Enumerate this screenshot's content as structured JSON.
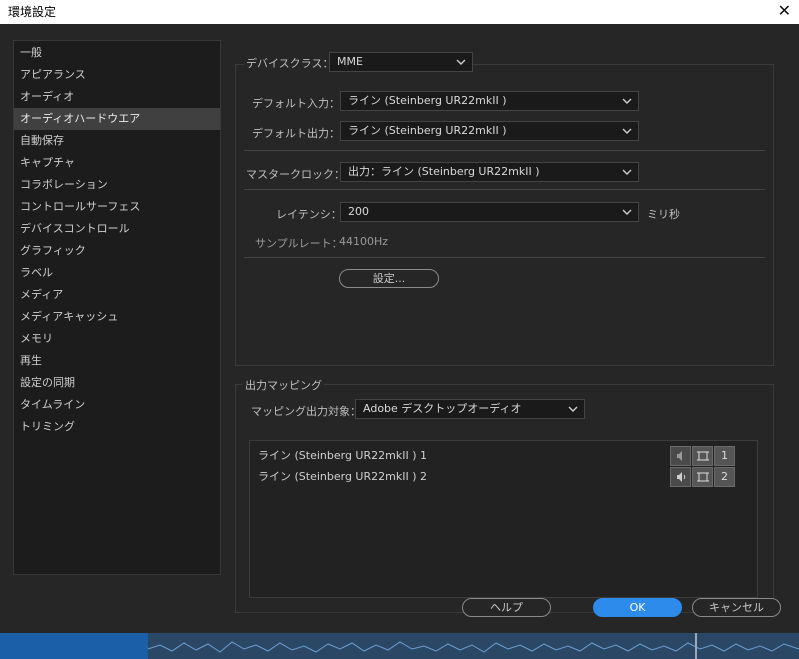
{
  "window": {
    "title": "環境設定",
    "close_glyph": "✕"
  },
  "sidebar": {
    "items": [
      {
        "label": "一般",
        "active": false
      },
      {
        "label": "アピアランス",
        "active": false
      },
      {
        "label": "オーディオ",
        "active": false
      },
      {
        "label": "オーディオハードウエア",
        "active": true
      },
      {
        "label": "自動保存",
        "active": false
      },
      {
        "label": "キャプチャ",
        "active": false
      },
      {
        "label": "コラボレーション",
        "active": false
      },
      {
        "label": "コントロールサーフェス",
        "active": false
      },
      {
        "label": "デバイスコントロール",
        "active": false
      },
      {
        "label": "グラフィック",
        "active": false
      },
      {
        "label": "ラベル",
        "active": false
      },
      {
        "label": "メディア",
        "active": false
      },
      {
        "label": "メディアキャッシュ",
        "active": false
      },
      {
        "label": "メモリ",
        "active": false
      },
      {
        "label": "再生",
        "active": false
      },
      {
        "label": "設定の同期",
        "active": false
      },
      {
        "label": "タイムライン",
        "active": false
      },
      {
        "label": "トリミング",
        "active": false
      }
    ]
  },
  "device": {
    "class_label": "デバイスクラス：",
    "class_value": "MME",
    "default_input_label": "デフォルト入力：",
    "default_input_value": "ライン (Steinberg UR22mkII )",
    "default_output_label": "デフォルト出力：",
    "default_output_value": "ライン (Steinberg UR22mkII )",
    "master_clock_label": "マスタークロック：",
    "master_clock_value": "出力：ライン (Steinberg UR22mkII )",
    "latency_label": "レイテンシ：",
    "latency_value": "200",
    "latency_unit": "ミリ秒",
    "sample_rate_label": "サンプルレート：",
    "sample_rate_value": "44100Hz",
    "settings_button": "設定..."
  },
  "mapping": {
    "group_label": "出力マッピング",
    "target_label": "マッピング出力対象：",
    "target_value": "Adobe デスクトップオーディオ",
    "rows": [
      {
        "label": "ライン (Steinberg UR22mkII ) 1",
        "channel": "1"
      },
      {
        "label": "ライン (Steinberg UR22mkII ) 2",
        "channel": "2"
      }
    ]
  },
  "buttons": {
    "help": "ヘルプ",
    "ok": "OK",
    "cancel": "キャンセル"
  },
  "colors": {
    "accent": "#2d8ceb",
    "background": "#262626",
    "sidebar": "#1c1c1c",
    "selected": "#404040"
  }
}
